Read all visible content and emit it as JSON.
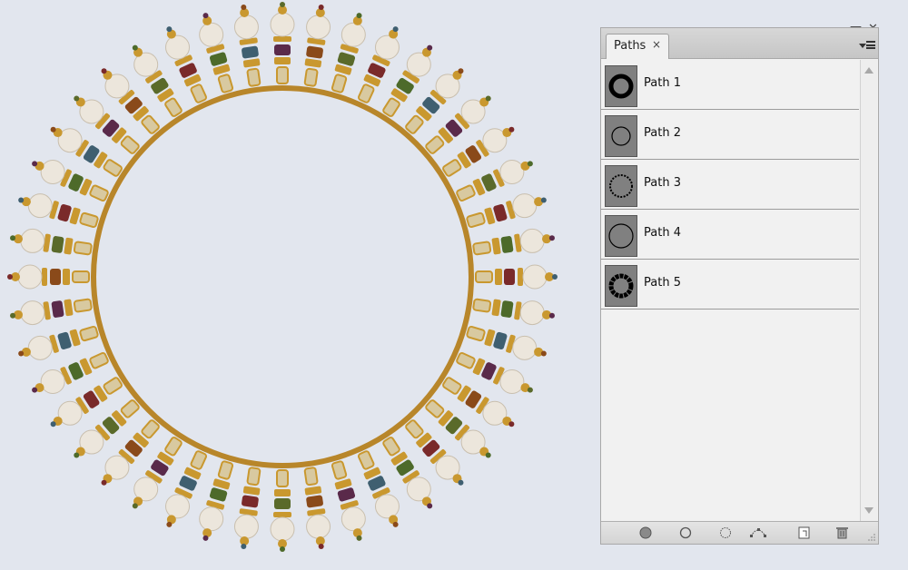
{
  "panel": {
    "tab_label": "Paths",
    "tab_close_glyph": "×",
    "close_glyph": "✕",
    "minimize_glyph": "—",
    "menu_icon": "panel-menu-icon",
    "paths": [
      {
        "name": "Path 1",
        "thumb": "thick-ring"
      },
      {
        "name": "Path 2",
        "thumb": "thin-ring"
      },
      {
        "name": "Path 3",
        "thumb": "dotted-ring"
      },
      {
        "name": "Path 4",
        "thumb": "thin-ring-large"
      },
      {
        "name": "Path 5",
        "thumb": "thick-ring-dotted"
      }
    ],
    "bottom_buttons": [
      {
        "name": "fill-path-button",
        "icon": "fill-circle-icon"
      },
      {
        "name": "stroke-path-button",
        "icon": "stroke-circle-icon"
      },
      {
        "name": "load-selection-button",
        "icon": "dotted-circle-icon"
      },
      {
        "name": "make-work-path-button",
        "icon": "work-path-icon"
      },
      {
        "name": "new-path-button",
        "icon": "new-page-icon"
      },
      {
        "name": "delete-path-button",
        "icon": "trash-icon"
      }
    ]
  },
  "colors": {
    "background": "#e2e6ee",
    "panel_bg": "#f1f1f1",
    "thumb_bg": "#808080",
    "gold": "#c9982f",
    "pearl": "#ece6dc"
  }
}
